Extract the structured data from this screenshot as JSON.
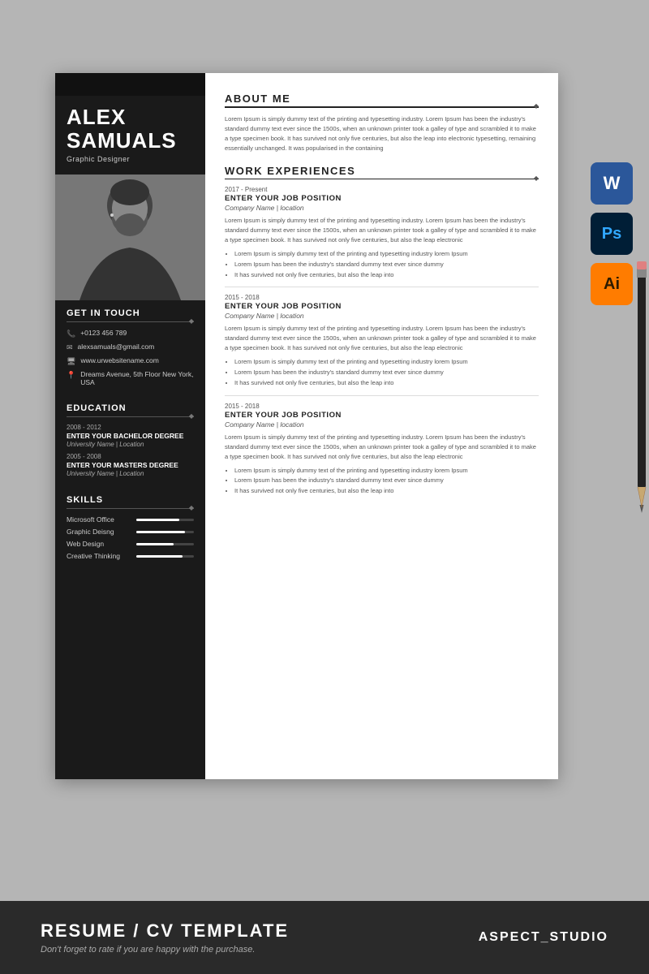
{
  "page": {
    "bg_color": "#b5b5b5"
  },
  "sidebar": {
    "top_bar": "",
    "first_name": "ALEX",
    "last_name": "SAMUALS",
    "job_title": "Graphic Designer",
    "contact": {
      "section_title": "GET IN TOUCH",
      "phone": "+0123 456 789",
      "email": "alexsamuals@gmail.com",
      "website": "www.urwebsitename.com",
      "address": "Dreams Avenue, 5th Floor New York, USA"
    },
    "education": {
      "section_title": "EDUCATION",
      "items": [
        {
          "years": "2008 - 2012",
          "degree": "ENTER YOUR BACHELOR DEGREE",
          "school": "University Name | Location"
        },
        {
          "years": "2005 - 2008",
          "degree": "ENTER YOUR MASTERS DEGREE",
          "school": "University Name | Location"
        }
      ]
    },
    "skills": {
      "section_title": "SKILLS",
      "items": [
        {
          "label": "Microsoft Office",
          "percent": 75
        },
        {
          "label": "Graphic Deisng",
          "percent": 85
        },
        {
          "label": "Web Design",
          "percent": 65
        },
        {
          "label": "Creative Thinking",
          "percent": 80
        }
      ]
    }
  },
  "main": {
    "about": {
      "title": "ABOUT ME",
      "text": "Lorem Ipsum is simply dummy text of the printing and typesetting industry. Lorem Ipsum has been the industry's standard dummy text ever since the 1500s, when an unknown printer took a galley of type and scrambled it to make a type specimen book. It has survived not only five centuries, but also the leap into electronic typesetting, remaining essentially unchanged. It was popularised in the containing"
    },
    "work": {
      "title": "WORK EXPERIENCES",
      "jobs": [
        {
          "years": "2017 - Present",
          "title": "ENTER YOUR JOB POSITION",
          "company": "Company Name  |  location",
          "desc": "Lorem Ipsum is simply dummy text of the printing and typesetting industry. Lorem Ipsum has been the industry's standard dummy text ever since the 1500s, when an unknown printer took a galley of type and scrambled it to make a type specimen book. It has survived not only five centuries, but also the leap electronic",
          "bullets": [
            "Lorem Ipsum is simply dummy text of the printing and typesetting industry lorem Ipsum",
            "Lorem Ipsum has been the industry's standard dummy text ever since dummy",
            "It has survived not only five centuries, but also the leap into"
          ]
        },
        {
          "years": "2015 - 2018",
          "title": "ENTER YOUR JOB POSITION",
          "company": "Company Name  |  location",
          "desc": "Lorem Ipsum is simply dummy text of the printing and typesetting industry. Lorem Ipsum has been the industry's standard dummy text ever since the 1500s, when an unknown printer took a galley of type and scrambled it to make a type specimen book. It has survived not only five centuries, but also the leap electronic",
          "bullets": [
            "Lorem Ipsum is simply dummy text of the printing and typesetting industry lorem Ipsum",
            "Lorem Ipsum has been the industry's standard dummy text ever since dummy",
            "It has survived not only five centuries, but also the leap into"
          ]
        },
        {
          "years": "2015 - 2018",
          "title": "ENTER YOUR JOB POSITION",
          "company": "Company Name  |  location",
          "desc": "Lorem Ipsum is simply dummy text of the printing and typesetting industry. Lorem Ipsum has been the industry's standard dummy text ever since the 1500s, when an unknown printer took a galley of type and scrambled it to make a type specimen book. It has survived not only five centuries, but also the leap electronic",
          "bullets": [
            "Lorem Ipsum is simply dummy text of the printing and typesetting industry lorem Ipsum",
            "Lorem Ipsum has been the industry's standard dummy text ever since dummy",
            "It has survived not only five centuries, but also the leap into"
          ]
        }
      ]
    }
  },
  "software_icons": [
    {
      "letter": "W",
      "super": "",
      "bg": "word",
      "label": "word-icon"
    },
    {
      "letter": "Ps",
      "super": "",
      "bg": "ps",
      "label": "photoshop-icon"
    },
    {
      "letter": "Ai",
      "super": "",
      "bg": "ai",
      "label": "illustrator-icon"
    }
  ],
  "footer": {
    "title": "RESUME / CV TEMPLATE",
    "subtitle": "Don't forget to rate if you are happy with the purchase.",
    "brand": "ASPECT_STUDIO"
  }
}
